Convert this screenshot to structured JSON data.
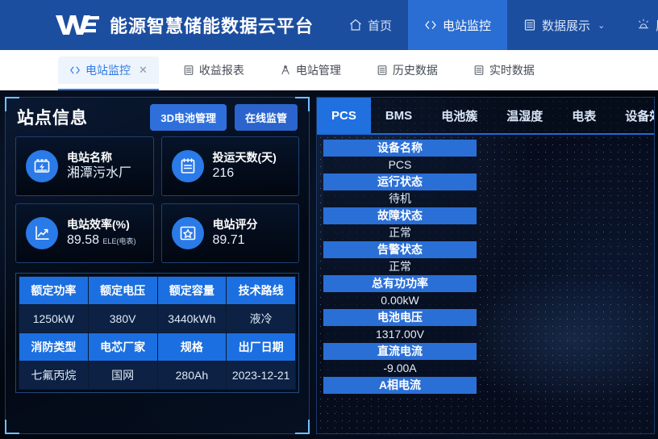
{
  "header": {
    "brand_title": "能源智慧储能数据云平台",
    "logo_name": "we-logo",
    "nav": [
      {
        "label": "首页",
        "icon": "home-icon",
        "active": false,
        "caret": false
      },
      {
        "label": "电站监控",
        "icon": "code-icon",
        "active": true,
        "caret": false
      },
      {
        "label": "数据展示",
        "icon": "database-icon",
        "active": false,
        "caret": true
      },
      {
        "label": "历史",
        "icon": "alarm-icon",
        "active": false,
        "caret": false
      }
    ]
  },
  "tabstrip": [
    {
      "label": "电站监控",
      "icon": "code-icon",
      "active": true,
      "closable": true,
      "close_glyph": "✕"
    },
    {
      "label": "收益报表",
      "icon": "database-icon",
      "active": false,
      "closable": false
    },
    {
      "label": "电站管理",
      "icon": "compass-icon",
      "active": false,
      "closable": false
    },
    {
      "label": "历史数据",
      "icon": "database-icon",
      "active": false,
      "closable": false
    },
    {
      "label": "实时数据",
      "icon": "database-icon",
      "active": false,
      "closable": false
    }
  ],
  "left_panel": {
    "title": "站点信息",
    "buttons": [
      {
        "label": "3D电池管理",
        "style": "solid"
      },
      {
        "label": "在线监管",
        "style": "outline"
      }
    ],
    "cards": [
      {
        "icon": "battery-charge-icon",
        "label": "电站名称",
        "value": "湘潭污水厂",
        "sub": ""
      },
      {
        "icon": "clipboard-icon",
        "label": "投运天数(天)",
        "value": "216",
        "sub": ""
      },
      {
        "icon": "trend-chart-icon",
        "label": "电站效率(%)",
        "value": "89.58",
        "sub": "ELE(电表)"
      },
      {
        "icon": "star-box-icon",
        "label": "电站评分",
        "value": "89.71",
        "sub": ""
      }
    ],
    "spec_table": {
      "rows": [
        {
          "type": "header",
          "cells": [
            "额定功率",
            "额定电压",
            "额定容量",
            "技术路线"
          ]
        },
        {
          "type": "data",
          "cells": [
            "1250kW",
            "380V",
            "3440kWh",
            "液冷"
          ]
        },
        {
          "type": "header",
          "cells": [
            "消防类型",
            "电芯厂家",
            "规格",
            "出厂日期"
          ]
        },
        {
          "type": "data",
          "cells": [
            "七氟丙烷",
            "国网",
            "280Ah",
            "2023-12-21"
          ]
        }
      ]
    }
  },
  "right_panel": {
    "tabs": [
      {
        "label": "PCS",
        "active": true
      },
      {
        "label": "BMS",
        "active": false
      },
      {
        "label": "电池簇",
        "active": false
      },
      {
        "label": "温湿度",
        "active": false
      },
      {
        "label": "电表",
        "active": false
      },
      {
        "label": "设备效",
        "active": false
      }
    ],
    "readouts": [
      {
        "key": "设备名称",
        "value": "PCS"
      },
      {
        "key": "运行状态",
        "value": "待机"
      },
      {
        "key": "故障状态",
        "value": "正常"
      },
      {
        "key": "告警状态",
        "value": "正常"
      },
      {
        "key": "总有功功率",
        "value": "0.00kW"
      },
      {
        "key": "电池电压",
        "value": "1317.00V"
      },
      {
        "key": "直流电流",
        "value": "-9.00A"
      },
      {
        "key": "A相电流",
        "value": ""
      }
    ]
  },
  "colors": {
    "nav_bg": "#1c4ea0",
    "nav_active": "#2a6ed4",
    "accent_blue": "#2f7ae5",
    "key_row": "#2a6fd6",
    "panel_border": "#3a78c8",
    "corner": "#6fc2ff",
    "table_header": "#1b6fe0",
    "table_cell": "#0c2143",
    "stage_bg": "#02060e"
  }
}
